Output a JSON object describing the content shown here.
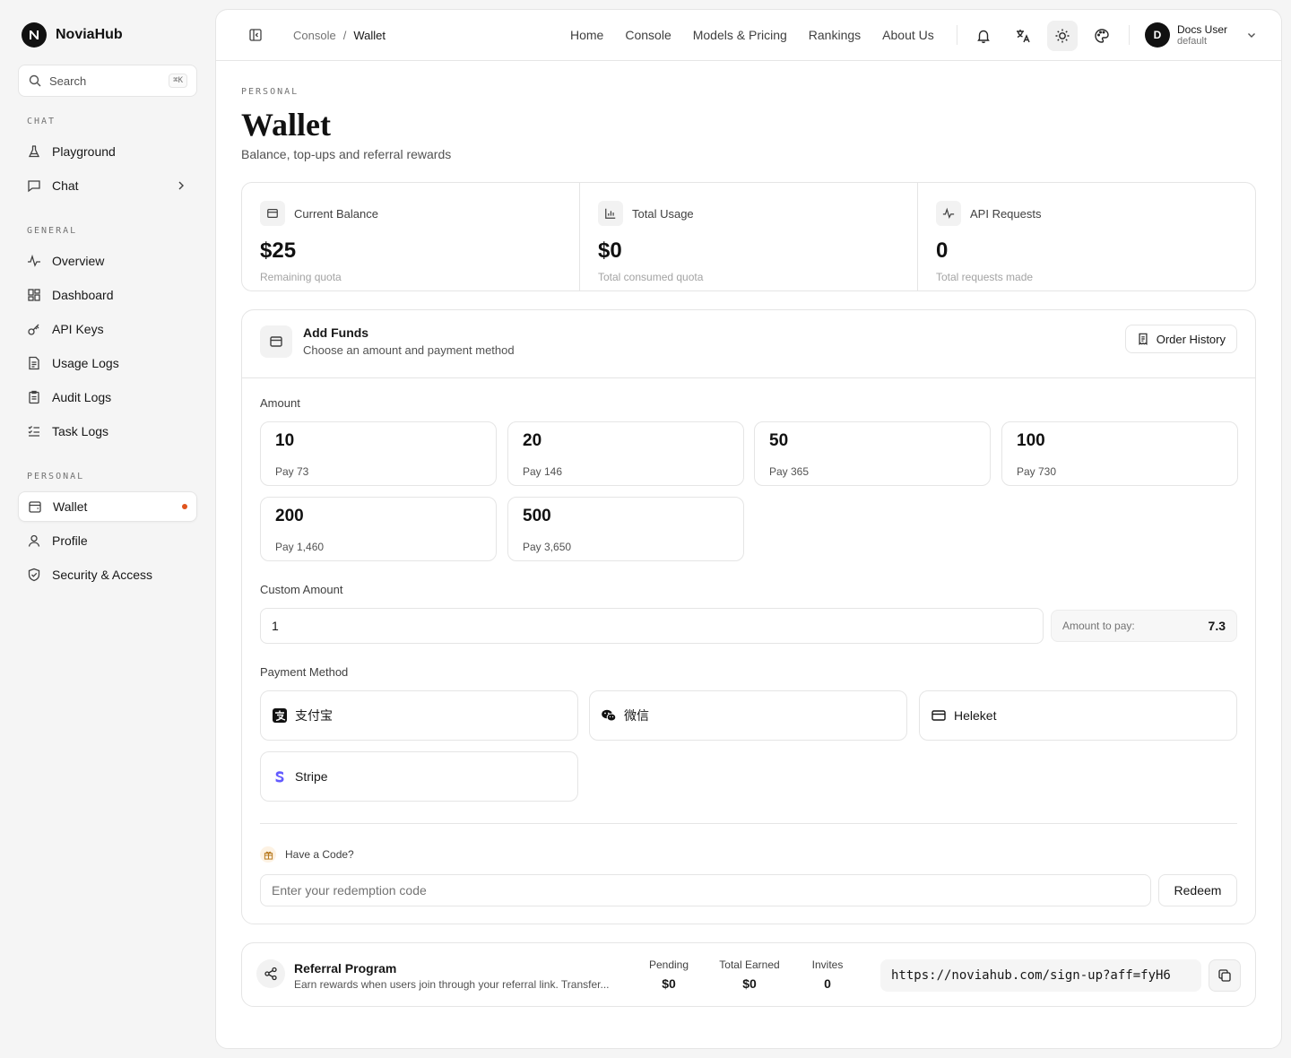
{
  "brand": {
    "name": "NoviaHub"
  },
  "search": {
    "placeholder": "Search",
    "shortcut": "⌘K"
  },
  "sidebar": {
    "sections": [
      {
        "label": "CHAT",
        "items": [
          {
            "label": "Playground"
          },
          {
            "label": "Chat"
          }
        ]
      },
      {
        "label": "GENERAL",
        "items": [
          {
            "label": "Overview"
          },
          {
            "label": "Dashboard"
          },
          {
            "label": "API Keys"
          },
          {
            "label": "Usage Logs"
          },
          {
            "label": "Audit Logs"
          },
          {
            "label": "Task Logs"
          }
        ]
      },
      {
        "label": "PERSONAL",
        "items": [
          {
            "label": "Wallet"
          },
          {
            "label": "Profile"
          },
          {
            "label": "Security & Access"
          }
        ]
      }
    ]
  },
  "breadcrumb": {
    "parent": "Console",
    "separator": "/",
    "current": "Wallet"
  },
  "topnav": [
    "Home",
    "Console",
    "Models & Pricing",
    "Rankings",
    "About Us"
  ],
  "user": {
    "initial": "D",
    "name": "Docs User",
    "role": "default"
  },
  "page": {
    "eyebrow": "PERSONAL",
    "title": "Wallet",
    "subtitle": "Balance, top-ups and referral rewards"
  },
  "stats": [
    {
      "label": "Current Balance",
      "value": "$25",
      "note": "Remaining quota"
    },
    {
      "label": "Total Usage",
      "value": "$0",
      "note": "Total consumed quota"
    },
    {
      "label": "API Requests",
      "value": "0",
      "note": "Total requests made"
    }
  ],
  "funds": {
    "title": "Add Funds",
    "subtitle": "Choose an amount and payment method",
    "order_history": "Order History",
    "amount_label": "Amount",
    "amounts": [
      {
        "value": "10",
        "pay": "Pay 73"
      },
      {
        "value": "20",
        "pay": "Pay 146"
      },
      {
        "value": "50",
        "pay": "Pay 365"
      },
      {
        "value": "100",
        "pay": "Pay 730"
      },
      {
        "value": "200",
        "pay": "Pay 1,460"
      },
      {
        "value": "500",
        "pay": "Pay 3,650"
      }
    ],
    "custom_label": "Custom Amount",
    "custom_value": "1",
    "pay_label": "Amount to pay:",
    "pay_value": "7.3",
    "method_label": "Payment Method",
    "methods": [
      {
        "label": "支付宝"
      },
      {
        "label": "微信"
      },
      {
        "label": "Heleket"
      },
      {
        "label": "Stripe"
      }
    ],
    "code_label": "Have a Code?",
    "code_placeholder": "Enter your redemption code",
    "redeem": "Redeem"
  },
  "referral": {
    "title": "Referral Program",
    "subtitle": "Earn rewards when users join through your referral link. Transfer...",
    "pending_label": "Pending",
    "pending": "$0",
    "earned_label": "Total Earned",
    "earned": "$0",
    "invites_label": "Invites",
    "invites": "0",
    "link": "https://noviahub.com/sign-up?aff=fyH6"
  },
  "colors": {
    "accent_dot": "#e0541d",
    "stripe": "#635bff"
  }
}
